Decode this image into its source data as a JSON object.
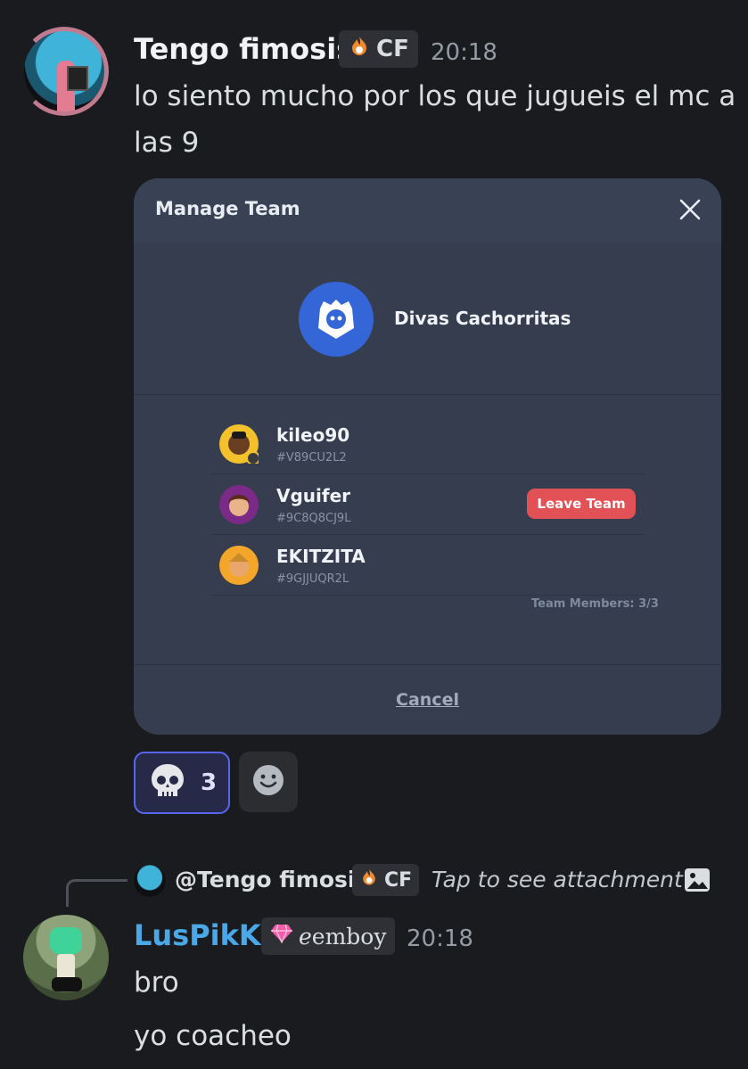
{
  "message1": {
    "username": "Tengo fimosis",
    "tag": "CF",
    "tag_icon": "fire-icon",
    "time": "20:18",
    "text": "lo siento mucho por los que jugueis el mc a las 9"
  },
  "attachment": {
    "title": "Manage Team",
    "team_name": "Divas Cachorritas",
    "members": [
      {
        "name": "kileo90",
        "tag": "#V89CU2L2"
      },
      {
        "name": "Vguifer",
        "tag": "#9C8Q8CJ9L"
      },
      {
        "name": "EKITZITA",
        "tag": "#9GJJUQR2L"
      }
    ],
    "leave_label": "Leave Team",
    "members_count": "Team Members: 3/3",
    "cancel_label": "Cancel",
    "colors": {
      "panel": "#353d4f",
      "team_icon": "#3466d8",
      "leave": "#e25155"
    }
  },
  "reactions": {
    "emoji": "skull-icon",
    "count": "3",
    "add_icon": "smiley-icon"
  },
  "reply": {
    "mention": "@Tengo fimosis",
    "tag": "CF",
    "text": "Tap to see attachment"
  },
  "message2": {
    "username": "LusPikK",
    "tag": "ℯemboy",
    "tag_icon": "gem-icon",
    "time": "20:18",
    "lines": [
      "bro",
      "yo coacheo"
    ]
  },
  "colors": {
    "background": "#1a1b1f",
    "accent": "#5865f2",
    "username2": "#4aa8e8"
  }
}
